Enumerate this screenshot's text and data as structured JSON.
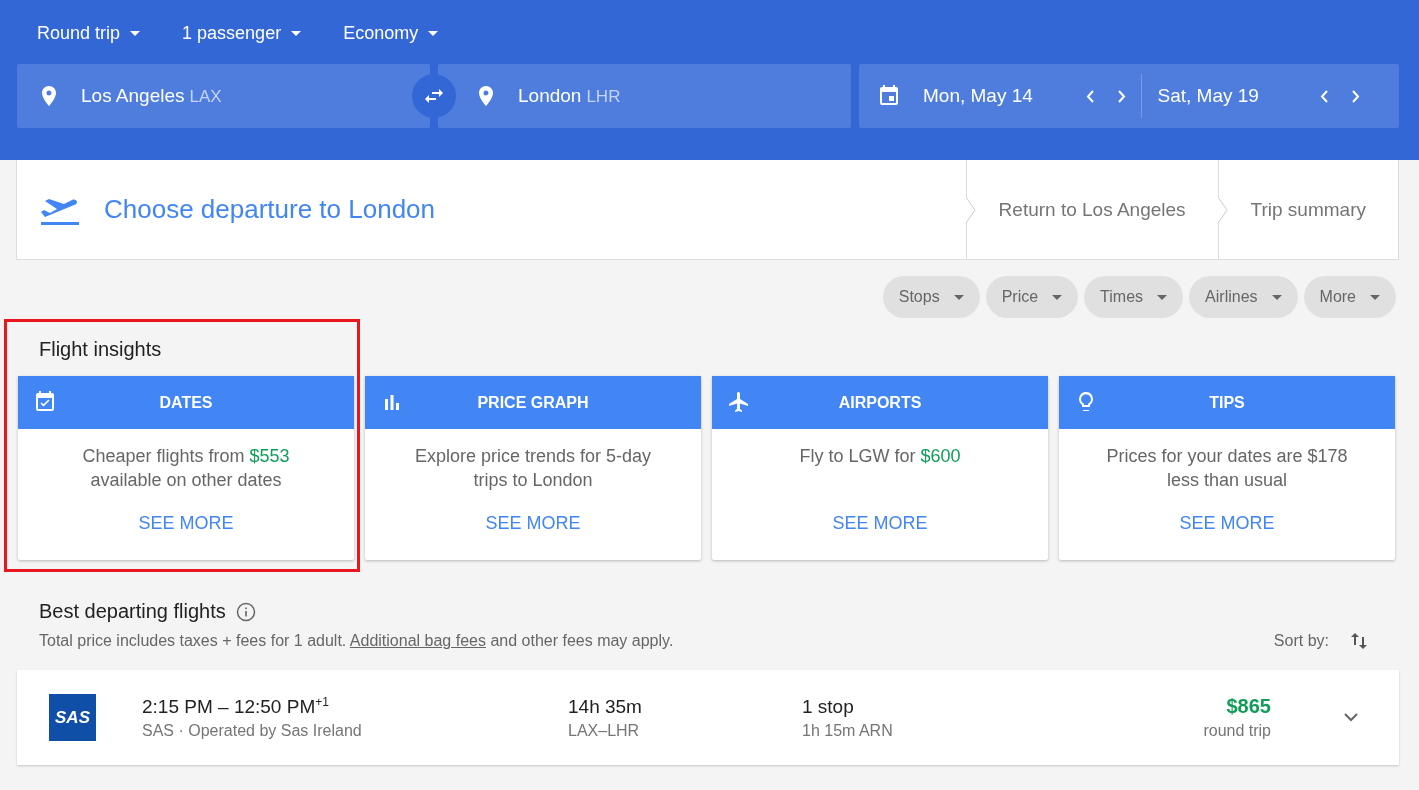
{
  "trip_options": [
    {
      "label": "Round trip"
    },
    {
      "label": "1 passenger"
    },
    {
      "label": "Economy"
    }
  ],
  "origin": {
    "city": "Los Angeles",
    "code": "LAX"
  },
  "destination": {
    "city": "London",
    "code": "LHR"
  },
  "dates": {
    "depart": "Mon, May 14",
    "return": "Sat, May 19"
  },
  "steps": [
    {
      "label": "Choose departure to London",
      "selected": true
    },
    {
      "label": "Return to Los Angeles",
      "selected": false
    },
    {
      "label": "Trip summary",
      "selected": false
    }
  ],
  "filters": [
    "Stops",
    "Price",
    "Times",
    "Airlines",
    "More"
  ],
  "insights": {
    "title": "Flight insights",
    "cards": [
      {
        "title": "DATES",
        "highlighted": true,
        "body": [
          {
            "kind": "plain",
            "text": "Cheaper flights from"
          },
          {
            "kind": "price",
            "text": "$553"
          },
          {
            "kind": "plain",
            "text": "available on other dates"
          }
        ],
        "action": "SEE MORE"
      },
      {
        "title": "PRICE GRAPH",
        "highlighted": false,
        "body": [
          {
            "kind": "plain",
            "text": "Explore price trends for 5-day trips to London"
          }
        ],
        "action": "SEE MORE"
      },
      {
        "title": "AIRPORTS",
        "highlighted": false,
        "body": [
          {
            "kind": "plain",
            "text": "Fly to LGW for"
          },
          {
            "kind": "price",
            "text": "$600"
          }
        ],
        "action": "SEE MORE"
      },
      {
        "title": "TIPS",
        "highlighted": false,
        "body": [
          {
            "kind": "plain",
            "text": "Prices for your dates are $178 less than usual"
          }
        ],
        "action": "SEE MORE"
      }
    ]
  },
  "results": {
    "title": "Best departing flights",
    "note_before": "Total price includes taxes + fees for 1 adult.",
    "note_link": "Additional bag fees",
    "note_after": "and other fees may apply.",
    "sort_label": "Sort by:",
    "flights": [
      {
        "logo": "SAS",
        "times": "2:15 PM – 12:50 PM",
        "day_offset": "+1",
        "airline": "SAS · Operated by Sas Ireland",
        "duration": "14h 35m",
        "route": "LAX–LHR",
        "stops": "1 stop",
        "layover": "1h 15m ARN",
        "price": "$865",
        "price_note": "round trip"
      }
    ]
  }
}
